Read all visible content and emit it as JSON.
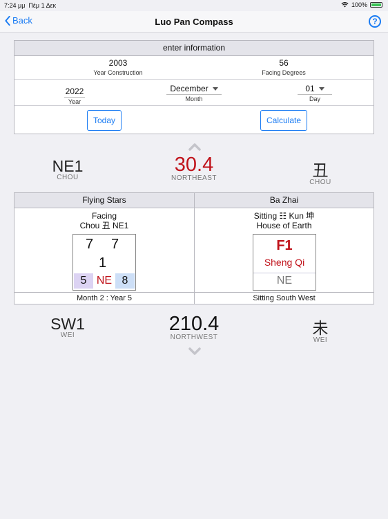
{
  "status_bar": {
    "time": "7:24 μμ",
    "date": "Πέμ 1 Δεκ",
    "battery": "100%",
    "battery_level": 1.0
  },
  "nav": {
    "back_label": "Back",
    "title": "Luo Pan Compass",
    "help_icon": "?"
  },
  "info": {
    "header": "enter information",
    "year_construction": {
      "value": "2003",
      "label": "Year Construction"
    },
    "facing_degrees": {
      "value": "56",
      "label": "Facing Degrees"
    },
    "year": {
      "value": "2022",
      "label": "Year"
    },
    "month": {
      "value": "December",
      "label": "Month"
    },
    "day": {
      "value": "01",
      "label": "Day"
    },
    "today_button": "Today",
    "calculate_button": "Calculate"
  },
  "facing": {
    "left_code": "NE1",
    "left_sub": "CHOU",
    "degrees": "30.4",
    "direction": "NORTHEAST",
    "right_char": "丑",
    "right_sub": "CHOU",
    "degrees_color": "#c0121a"
  },
  "flying_stars": {
    "header": "Flying Stars",
    "line1": "Facing",
    "line2": "Chou 丑 NE1",
    "top_left": "7",
    "top_right": "7",
    "center": "1",
    "bottom_left": "5",
    "bottom_mid": "NE",
    "bottom_right": "8",
    "footer": "Month 2 : Year 5",
    "color_purple": "#dcd3f3",
    "color_blue": "#cddff7",
    "color_red": "#c0121a"
  },
  "ba_zhai": {
    "header": "Ba Zhai",
    "line1": "Sitting ☷ Kun 坤",
    "line2": "House of Earth",
    "code": "F1",
    "name": "Sheng Qi",
    "dir": "NE",
    "footer": "Sitting South West"
  },
  "sitting": {
    "left_code": "SW1",
    "left_sub": "WEI",
    "degrees": "210.4",
    "direction": "NORTHWEST",
    "right_char": "未",
    "right_sub": "WEI"
  }
}
